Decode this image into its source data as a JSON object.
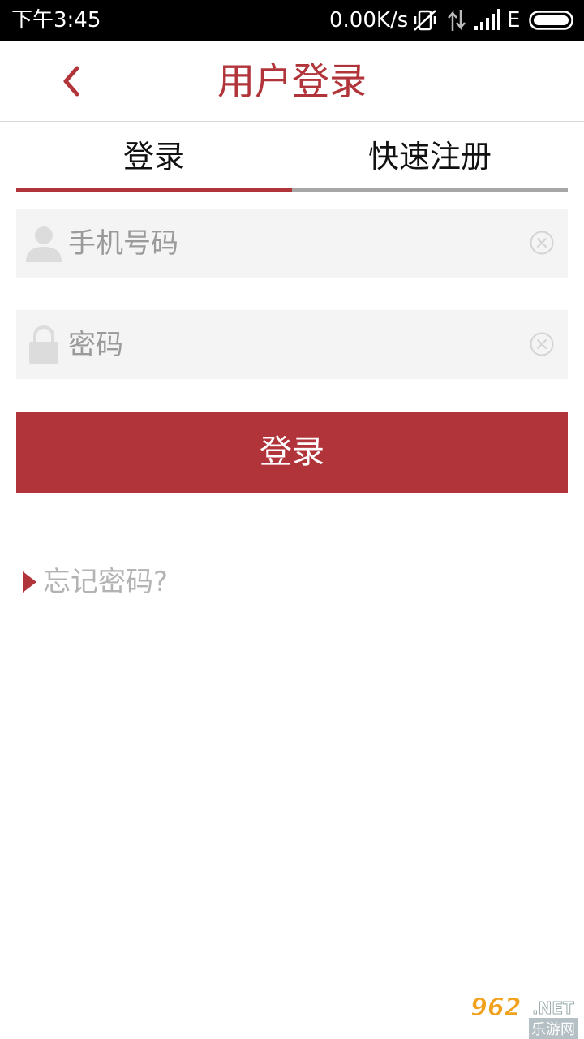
{
  "status_bar": {
    "time": "下午3:45",
    "speed": "0.00K/s",
    "network": "E",
    "icons": [
      "mute-vibrate-icon",
      "data-arrows-icon",
      "signal-icon",
      "battery-icon"
    ]
  },
  "header": {
    "title": "用户登录",
    "back_icon": "chevron-left-icon"
  },
  "tabs": [
    {
      "label": "登录",
      "active": true
    },
    {
      "label": "快速注册",
      "active": false
    }
  ],
  "form": {
    "phone_placeholder": "手机号码",
    "phone_value": "",
    "password_placeholder": "密码",
    "password_value": "",
    "submit_label": "登录"
  },
  "forgot_password": "忘记密码?",
  "watermark": {
    "main": "962",
    "suffix": ".NET",
    "sub": "乐游网"
  },
  "colors": {
    "accent": "#b1343a",
    "tab_inactive": "#a6a6a6",
    "field_bg": "#f4f4f4",
    "placeholder": "#9a9a9a"
  }
}
